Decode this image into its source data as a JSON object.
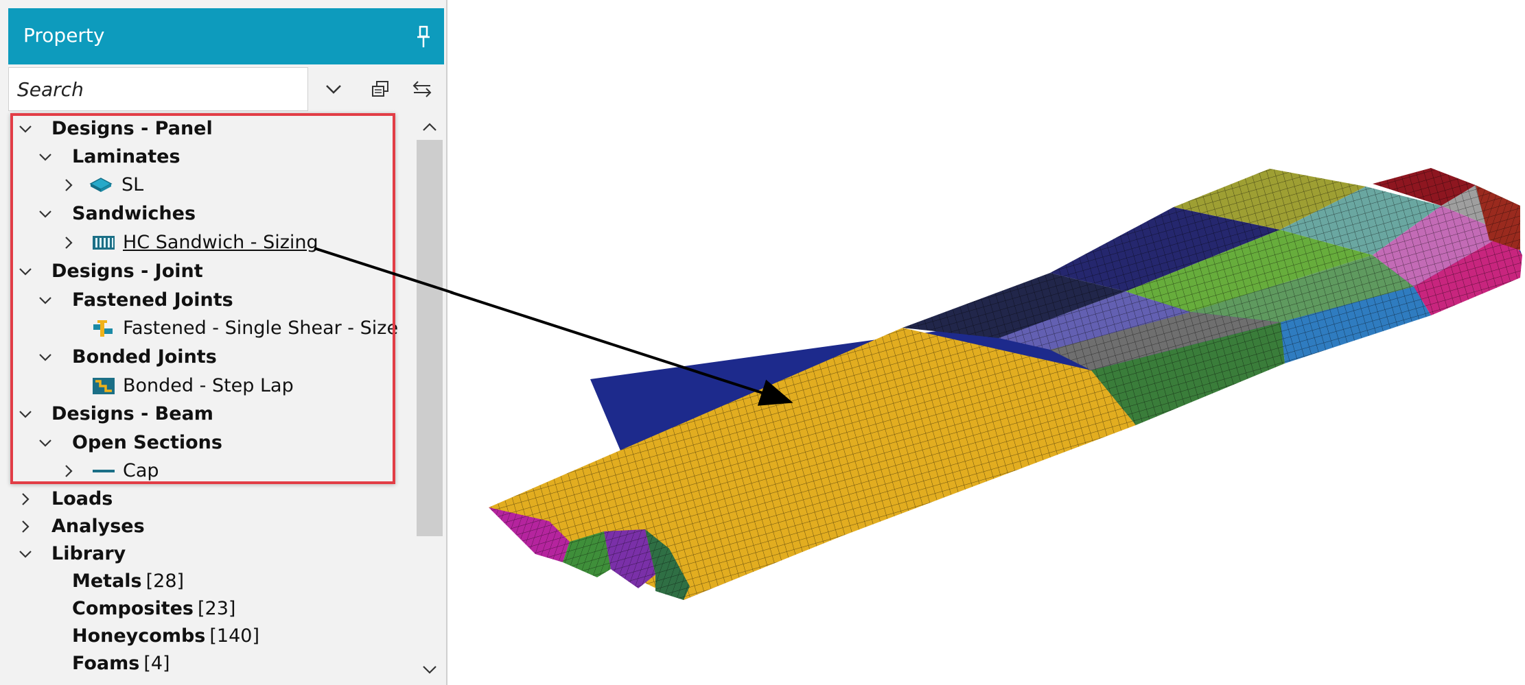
{
  "panel": {
    "title": "Property",
    "search_placeholder": "Search"
  },
  "tree": {
    "designs_panel": "Designs - Panel",
    "laminates": "Laminates",
    "sl": "SL",
    "sandwiches": "Sandwiches",
    "hc_sandwich": "HC Sandwich - Sizing",
    "designs_joint": "Designs - Joint",
    "fastened_joints": "Fastened Joints",
    "fastened_single_shear": "Fastened - Single Shear - Size",
    "bonded_joints": "Bonded Joints",
    "bonded_step_lap": "Bonded - Step Lap",
    "designs_beam": "Designs - Beam",
    "open_sections": "Open Sections",
    "cap": "Cap",
    "loads": "Loads",
    "analyses": "Analyses",
    "library": "Library",
    "metals": "Metals",
    "metals_count": "[28]",
    "composites": "Composites",
    "composites_count": "[23]",
    "honeycombs": "Honeycombs",
    "honeycombs_count": "[140]",
    "foams": "Foams",
    "foams_count": "[4]"
  },
  "icons": {
    "pin": "pin-icon",
    "dropdown": "chevron-down-icon",
    "copy": "copy-windows-icon",
    "swap": "swap-arrows-icon",
    "laminate": "laminate-icon",
    "sandwich": "sandwich-icon",
    "fastened": "fastened-joint-icon",
    "bonded": "bonded-joint-icon",
    "beam": "beam-section-icon"
  },
  "colors": {
    "header": "#0d9bbd",
    "highlight": "#e23d46",
    "icon_teal": "#1b8aa6"
  }
}
